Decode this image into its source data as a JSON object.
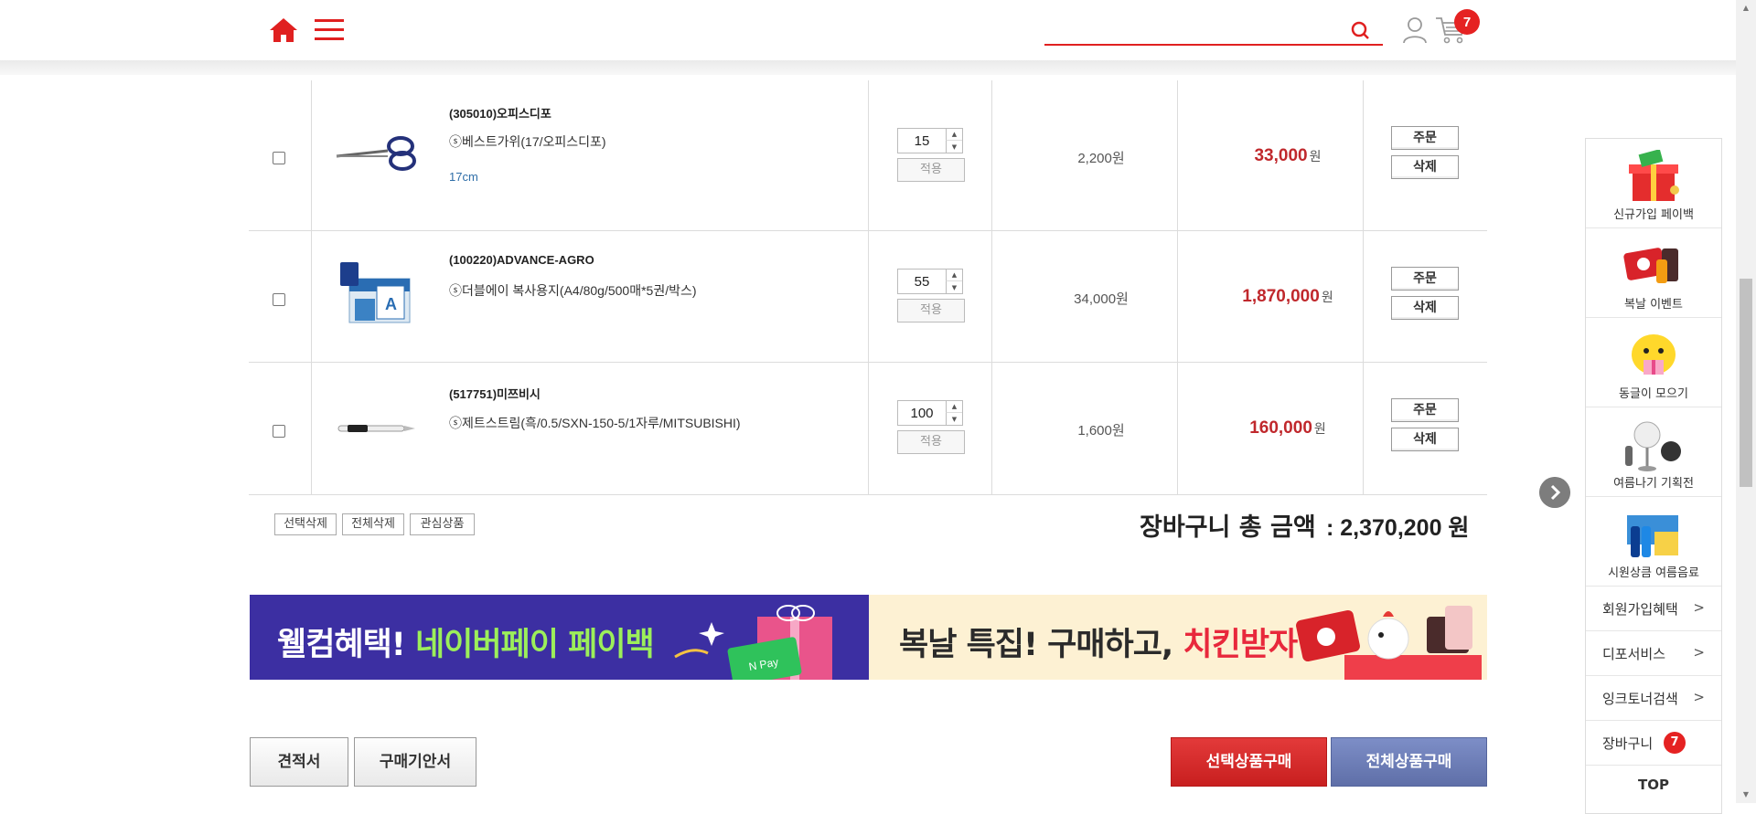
{
  "header": {
    "search_placeholder": "",
    "cart_count": "7"
  },
  "cart_items": [
    {
      "code": "(305010)오피스디포",
      "name": "ⓢ베스트가위(17/오피스디포)",
      "option": "17cm",
      "qty": "15",
      "apply_label": "적용",
      "unit_price": "2,200원",
      "total_price": "33,000",
      "total_unit": "원",
      "order_label": "주문",
      "delete_label": "삭제"
    },
    {
      "code": "(100220)ADVANCE-AGRO",
      "name": "ⓢ더블에이 복사용지(A4/80g/500매*5권/박스)",
      "option": "",
      "qty": "55",
      "apply_label": "적용",
      "unit_price": "34,000원",
      "total_price": "1,870,000",
      "total_unit": "원",
      "order_label": "주문",
      "delete_label": "삭제"
    },
    {
      "code": "(517751)미쯔비시",
      "name": "ⓢ제트스트림(흑/0.5/SXN-150-5/1자루/MITSUBISHI)",
      "option": "",
      "qty": "100",
      "apply_label": "적용",
      "unit_price": "1,600원",
      "total_price": "160,000",
      "total_unit": "원",
      "order_label": "주문",
      "delete_label": "삭제"
    }
  ],
  "summary": {
    "delete_selected": "선택삭제",
    "delete_all": "전체삭제",
    "wishlist": "관심상품",
    "total_label": "장바구니 총 금액",
    "total_value": ": 2,370,200 원"
  },
  "banners": {
    "left_prefix": "웰컴혜택! ",
    "left_highlight": "네이버페이 페이백",
    "right_prefix": "복날 특집! 구매하고, ",
    "right_highlight": "치킨받자"
  },
  "bottom_buttons": {
    "quote": "견적서",
    "purchase_guide": "구매기안서",
    "buy_selected": "선택상품구매",
    "buy_all": "전체상품구매"
  },
  "right_panel": {
    "items": [
      {
        "label": "신규가입 페이백"
      },
      {
        "label": "복날 이벤트"
      },
      {
        "label": "동글이 모으기"
      },
      {
        "label": "여름나기 기획전"
      },
      {
        "label": "시원상큼 여름음료"
      }
    ],
    "links": [
      {
        "label": "회원가입혜택",
        "arrow": ">"
      },
      {
        "label": "디포서비스",
        "arrow": ">"
      },
      {
        "label": "잉크토너검색",
        "arrow": ">"
      }
    ],
    "cart_label": "장바구니",
    "cart_count": "7",
    "top_label": "TOP"
  },
  "colors": {
    "accent_red": "#e02020",
    "price_red": "#c0282c",
    "buy_all_blue": "#6373ac",
    "banner_left_bg": "#3c2fa2",
    "banner_right_bg": "#fdf1d3"
  }
}
